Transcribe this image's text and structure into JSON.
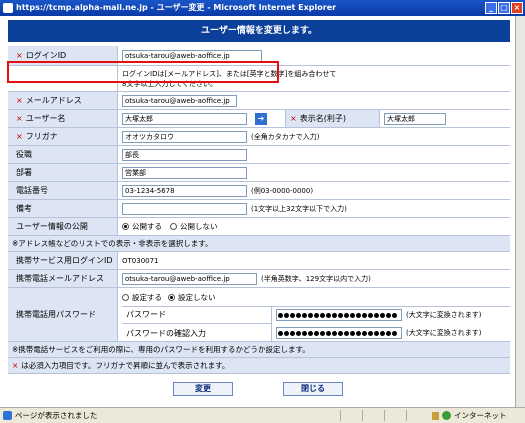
{
  "window": {
    "title": "https://tcmp.alpha-mail.ne.jp - ユーザー変更 - Microsoft Internet Explorer",
    "minimize": "_",
    "maximize": "□",
    "close": "×"
  },
  "header": {
    "title": "ユーザー情報を変更します。"
  },
  "required_mark": "×",
  "fields": {
    "login_id": {
      "label": "ログインID",
      "value": "otsuka-tarou@aweb-aoffice.jp",
      "help1": "ログインIDは[メールアドレス]、または[英字と数字]を組み合わせて",
      "help2": "8文字以上入力してください。"
    },
    "mail": {
      "label": "メールアドレス",
      "value": "otsuka-tarou@aweb-aoffice.jp"
    },
    "user_name": {
      "label": "ユーザー名",
      "value": "大塚太郎",
      "arrow": "➔"
    },
    "display_name": {
      "label": "表示名(利子)",
      "value": "大塚太郎"
    },
    "furigana": {
      "label": "フリガナ",
      "value": "オオツカタロウ",
      "note": "(全角カタカナで入力)"
    },
    "position": {
      "label": "役職",
      "value": "部長"
    },
    "department": {
      "label": "部署",
      "value": "営業部"
    },
    "phone": {
      "label": "電話番号",
      "value": "03-1234-5678",
      "note": "(例03-0000-0000)"
    },
    "remarks": {
      "label": "備考",
      "value": "",
      "note": "(1文字以上32文字以下で入力)"
    },
    "publish": {
      "label": "ユーザー情報の公開",
      "opt_on": "公開する",
      "opt_off": "公開しない"
    }
  },
  "notes": {
    "publish_note": "※アドレス帳などのリストでの表示・非表示を選択します。",
    "mobile_note": "※携帯電話サービスをご利用の際に、専用のパスワードを利用するかどうか設定します。",
    "required_note": "は必須入力項目です。フリガナで昇順に並んで表示されます。"
  },
  "mobile": {
    "login_label": "携帯サービス用ログインID",
    "login_value": "OT030071",
    "mail_label": "携帯電話メールアドレス",
    "mail_value": "otsuka-tarou@aweb-aoffice.jp",
    "mail_note": "(半角英数字、129文字以内で入力)",
    "pw_label": "携帯電話用パスワード",
    "opt_set": "設定する",
    "opt_noset": "設定しない",
    "pw_sub": "パスワード",
    "pw_confirm_sub": "パスワードの確認入力",
    "pw_note": "(大文字に変換されます)"
  },
  "buttons": {
    "submit": "変更",
    "close": "閉じる"
  },
  "status": {
    "text": "ページが表示されました",
    "zone": "インターネット"
  }
}
